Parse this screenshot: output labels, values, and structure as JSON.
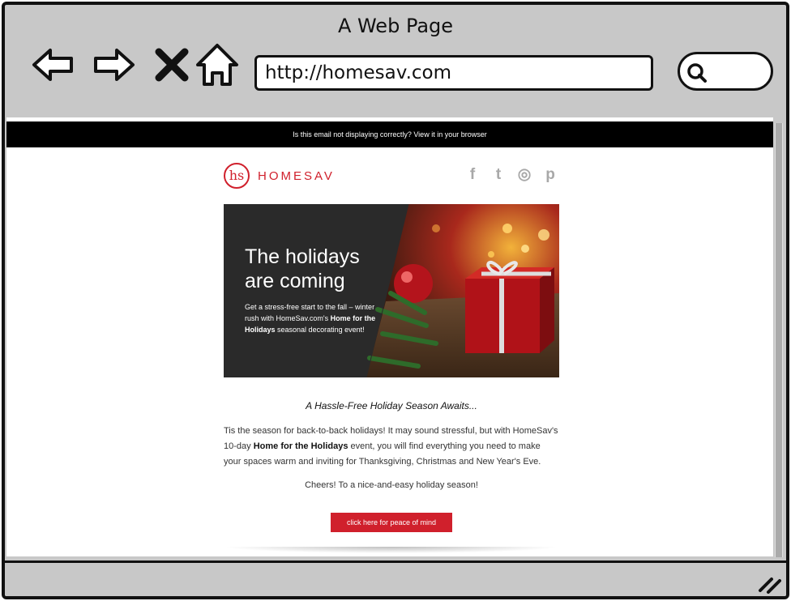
{
  "window": {
    "title": "A Web Page",
    "url": "http://homesav.com"
  },
  "email": {
    "view_in_browser": "Is this email not displaying correctly? View it in your browser",
    "brand": {
      "mark": "hs",
      "name": "HOMESAV",
      "color": "#d0202c"
    },
    "social_icons": [
      "facebook-icon",
      "twitter-icon",
      "instagram-icon",
      "pinterest-icon"
    ],
    "social_glyphs": {
      "facebook": "f",
      "twitter": "t",
      "instagram": "◎",
      "pinterest": "p"
    },
    "banner": {
      "title_line1": "The holidays",
      "title_line2": "are coming",
      "sub_pre": "Get a stress-free start to the fall – winter rush with HomeSav.com's",
      "sub_bold": "Home for the Holidays",
      "sub_post": "seasonal decorating event!"
    },
    "headline": "A Hassle-Free Holiday Season Awaits...",
    "body_pre": "Tis the season for back-to-back holidays! It may sound stressful, but with HomeSav's 10-day",
    "body_bold": "Home for the Holidays",
    "body_post": "event, you will find everything you need to make your spaces warm and inviting for Thanksgiving, Christmas and New Year's Eve.",
    "cheers": "Cheers! To a nice-and-easy holiday season!",
    "cta": "click here for peace of mind"
  }
}
